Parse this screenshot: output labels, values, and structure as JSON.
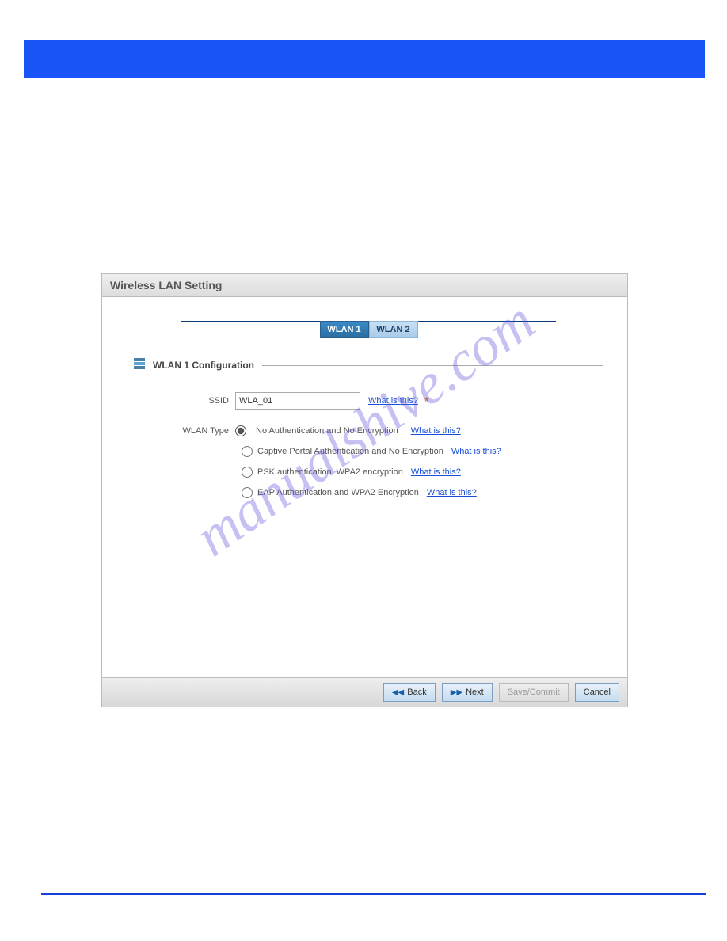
{
  "dialog": {
    "title": "Wireless LAN Setting",
    "tabs": [
      {
        "label": "WLAN 1",
        "active": true
      },
      {
        "label": "WLAN 2",
        "active": false
      }
    ],
    "section_title": "WLAN 1 Configuration",
    "ssid": {
      "label": "SSID",
      "value": "WLA_01",
      "help": "What is this?"
    },
    "wlan_type_label": "WLAN Type",
    "options": [
      {
        "label": "No Authentication and No Encryption",
        "help": "What is this?",
        "checked": true
      },
      {
        "label": "Captive Portal Authentication and No Encryption",
        "help": "What is this?",
        "checked": false
      },
      {
        "label": "PSK authentication, WPA2 encryption",
        "help": "What is this?",
        "checked": false
      },
      {
        "label": "EAP Authentication and WPA2 Encryption",
        "help": "What is this?",
        "checked": false
      }
    ],
    "buttons": {
      "back": "Back",
      "next": "Next",
      "save": "Save/Commit",
      "cancel": "Cancel"
    }
  },
  "watermark": "manualshive.com"
}
